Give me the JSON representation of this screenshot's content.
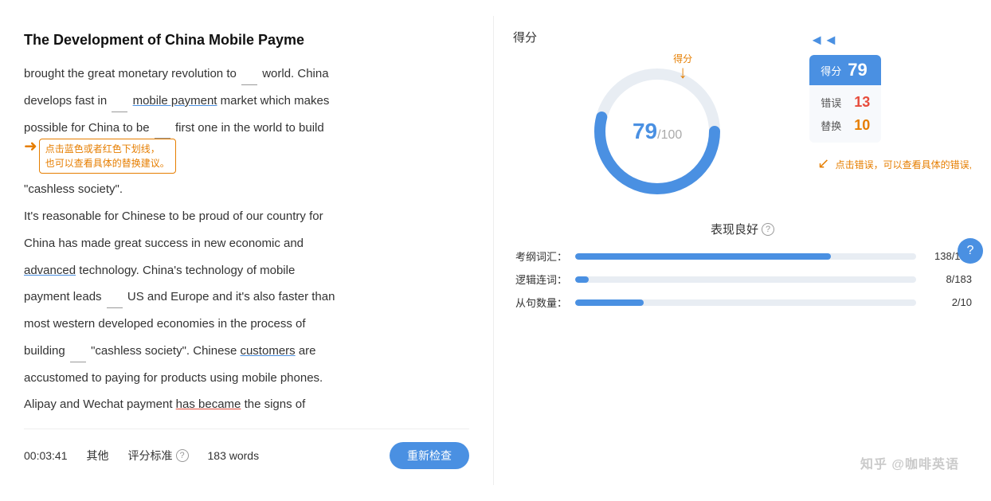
{
  "title": "The Development of China Mobile Payme",
  "essay": {
    "line1": "brought the great monetary revolution to",
    "line1_blank": true,
    "line1_cont": "world. China",
    "line2_start": "develops fast in",
    "line2_underline": "mobile payment",
    "line2_end": "market which makes",
    "line3_start": "possible for China to be",
    "line3_blank": true,
    "line3_mid": "first one in the world to build",
    "line4": "\"cashless society\".",
    "line5_start": "It's reasonable for Chinese to be proud of our country for",
    "line6": "China has made great success in new economic and",
    "line7_underline": "advanced",
    "line7_end": "technology. China's technology of mobile",
    "line8_start": "payment leads",
    "line8_blank": true,
    "line8_mid": "US and Europe and it's also faster than",
    "line9": "most western developed economies in the process of",
    "line10_start": "building",
    "line10_blank": true,
    "line10_mid": "\"cashless society\". Chinese",
    "line10_underline": "customers",
    "line10_end": "are",
    "line11": "accustomed to paying for products using mobile phones.",
    "line12_start": "Alipay and Wechat payment",
    "line12_underline": "has became",
    "line12_end": "the signs of"
  },
  "tooltip": {
    "arrow_label": "点击蓝色或者红色下划线，\n也可以查看具体的替换建议。"
  },
  "right_annotation": "点击错误，可以查看具体的错误,",
  "score_section": {
    "label": "得分",
    "gauge_label": "得分",
    "score": "79",
    "total": "100",
    "cards": {
      "header_label": "得分",
      "header_value": "79",
      "rows": [
        {
          "label": "错误",
          "value": "13"
        },
        {
          "label": "替换",
          "value": "10"
        }
      ]
    }
  },
  "performance": {
    "title": "表现良好",
    "metrics": [
      {
        "name": "考纲词汇：",
        "value": "138/183",
        "fill_pct": 75
      },
      {
        "name": "逻辑连词：",
        "value": "8/183",
        "fill_pct": 4
      },
      {
        "name": "从句数量：",
        "value": "2/10",
        "fill_pct": 20
      }
    ]
  },
  "footer": {
    "time": "00:03:41",
    "category": "其他",
    "criteria_label": "评分标准",
    "word_count": "183 words",
    "recheck_btn": "重新检查"
  },
  "watermark": "知乎 @咖啡英语"
}
